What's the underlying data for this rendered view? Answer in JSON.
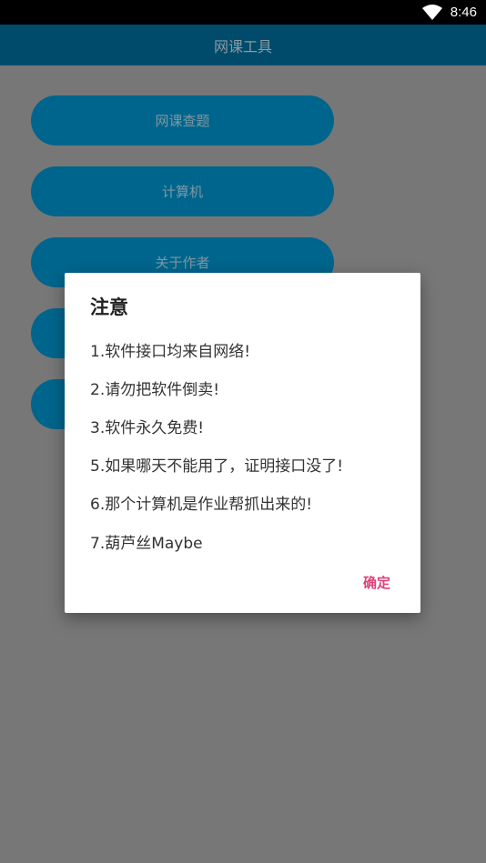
{
  "status_bar": {
    "time": "8:46",
    "wifi_icon": "wifi-icon"
  },
  "app_bar": {
    "title": "网课工具"
  },
  "menu": [
    {
      "label": "网课查题"
    },
    {
      "label": "计算机"
    },
    {
      "label": "关于作者"
    },
    {
      "label": ""
    },
    {
      "label": ""
    }
  ],
  "dialog": {
    "title": "注意",
    "lines": [
      "1.软件接口均来自网络!",
      "2.请勿把软件倒卖!",
      "3.软件永久免费!",
      "5.如果哪天不能用了，证明接口没了!",
      "6.那个计算机是作业帮抓出来的!",
      "7.葫芦丝Maybe"
    ],
    "ok_label": "确定"
  },
  "colors": {
    "app_bar": "#004b6b",
    "button": "#00658c",
    "scrim": "#777777",
    "accent": "#e0407b"
  }
}
